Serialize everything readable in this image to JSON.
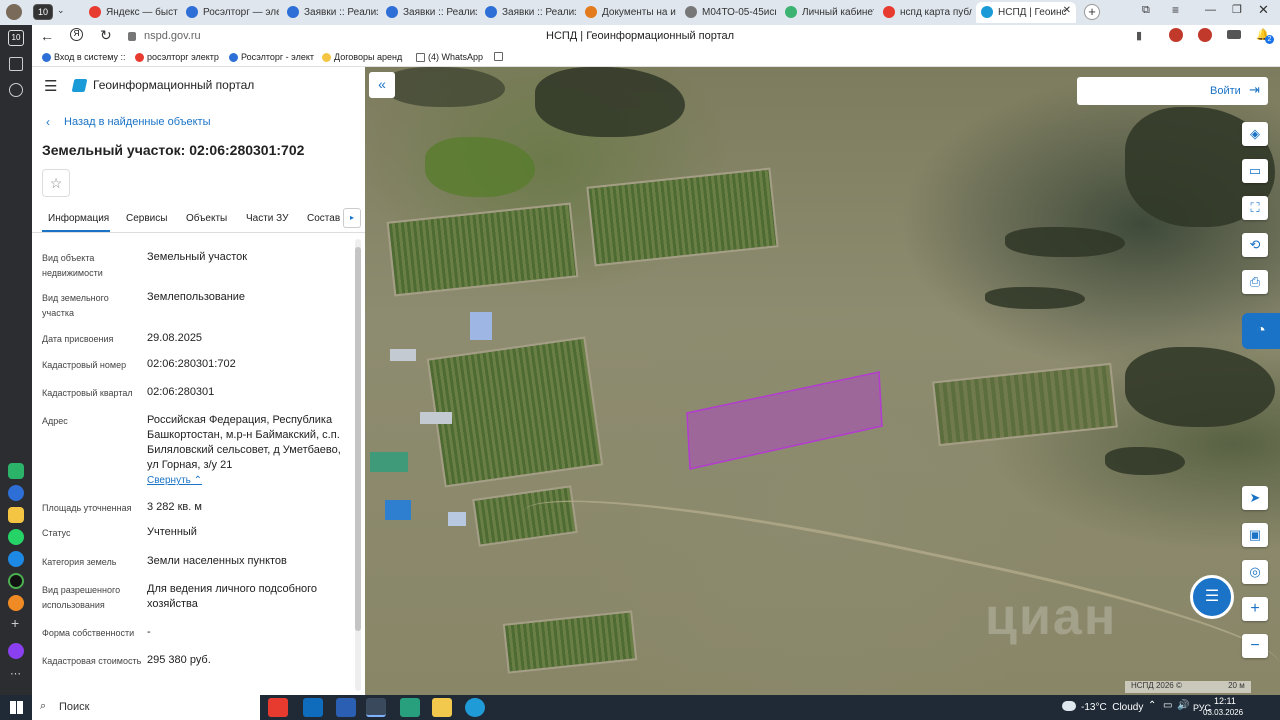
{
  "browser": {
    "tab_counter": "10",
    "tabs": [
      {
        "label": "Яндекс — быстр",
        "color": "#e83b2f"
      },
      {
        "label": "Росэлторг — эле",
        "color": "#2d6fd6"
      },
      {
        "label": "Заявки :: Реализ",
        "color": "#2d6fd6"
      },
      {
        "label": "Заявки :: Реализ",
        "color": "#2d6fd6"
      },
      {
        "label": "Заявки :: Реализ",
        "color": "#2d6fd6"
      },
      {
        "label": "Документы на из",
        "color": "#e37b1c"
      },
      {
        "label": "М04ТО-05-45иск",
        "color": "#777777"
      },
      {
        "label": "Личный кабинет",
        "color": "#3cb371"
      },
      {
        "label": "нспд карта публ",
        "color": "#e83b2f"
      },
      {
        "label": "НСПД | Геоинс",
        "color": "#1a9bd7"
      }
    ],
    "url": "nspd.gov.ru",
    "page_title": "НСПД | Геоинформационный портал",
    "bookmarks": [
      "Вход в систему :: ",
      "росэлторг электр",
      "Росэлторг - элект",
      "Договоры аренд",
      "(4) WhatsApp"
    ],
    "notification_count": "2"
  },
  "panel": {
    "portal_title": "Геоинформационный портал",
    "back_link": "Назад в найденные объекты",
    "object_title": "Земельный участок: 02:06:280301:702",
    "tabs": [
      "Информация",
      "Сервисы",
      "Объекты",
      "Части ЗУ",
      "Состав"
    ],
    "active_tab": "Информация",
    "fields": [
      {
        "label": "Вид объекта недвижимости",
        "value": "Земельный участок"
      },
      {
        "label": "Вид земельного участка",
        "value": "Землепользование"
      },
      {
        "label": "Дата присвоения",
        "value": "29.08.2025"
      },
      {
        "label": "Кадастровый номер",
        "value": "02:06:280301:702"
      },
      {
        "label": "Кадастровый квартал",
        "value": "02:06:280301"
      },
      {
        "label": "Адрес",
        "value": "Российская Федерация, Республика Башкортостан, м.р-н Баймакский, с.п. Биляловский сельсовет, д Уметбаево, ул Горная, з/у 21"
      },
      {
        "label": "Площадь уточненная",
        "value": "3 282 кв. м"
      },
      {
        "label": "Статус",
        "value": "Учтенный"
      },
      {
        "label": "Категория земель",
        "value": "Земли населенных пунктов"
      },
      {
        "label": "Вид разрешенного использования",
        "value": "Для ведения личного подсобного хозяйства"
      },
      {
        "label": "Форма собственности",
        "value": "-"
      },
      {
        "label": "Кадастровая стоимость",
        "value": "295 380 руб."
      }
    ],
    "collapse_link": "Свернуть"
  },
  "map": {
    "login_label": "Войти",
    "attribution": "НСПД 2026 ©",
    "scale_label": "20 м",
    "watermark": "циан",
    "parcel_color": "#b33bd0"
  },
  "taskbar": {
    "search_label": "Поиск",
    "weather": "-13°C  Cloudy",
    "language": "РУС",
    "time": "12:11",
    "date": "03.03.2026"
  }
}
